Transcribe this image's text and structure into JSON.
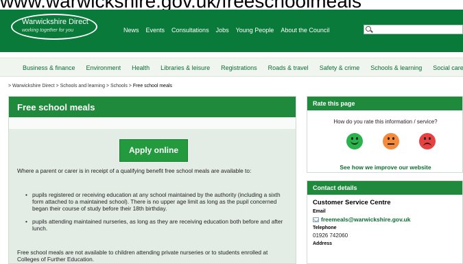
{
  "caption": {
    "url_text": "www.warwickshire.gov.uk/freeschoolmeals"
  },
  "header": {
    "logo_main": "Warwickshire Direct",
    "logo_sub": "working together for you",
    "nav": [
      "News",
      "Events",
      "Consultations",
      "Jobs",
      "Young People",
      "About the Council"
    ],
    "search": {
      "value": "",
      "icon": "search-icon"
    },
    "color": "#0a7a3a"
  },
  "main_nav": [
    "Business & finance",
    "Environment",
    "Health",
    "Libraries & leisure",
    "Registrations",
    "Roads & travel",
    "Safety & crime",
    "Schools & learning",
    "Social care"
  ],
  "breadcrumb": {
    "trail": "> Warwickshire Direct > Schools and learning > Schools > ",
    "current": "Free school meals"
  },
  "content": {
    "title": "Free school meals",
    "apply_label": "Apply online",
    "intro": "Where a parent or carer is in receipt of a qualifying benefit free school meals are available to:",
    "bullets": [
      "pupils registered or receiving education at any school maintained by the authority (including a sixth form attached to a maintained school). There is no upper age limit as long as the pupil concerned began their course of study before their 18th birthday.",
      "pupils attending maintained nurseries, as long as they are receiving education both before and after lunch."
    ],
    "footer": "Free school meals are not available to children attending private nurseries or to students enrolled at Colleges of Further Education."
  },
  "rate_panel": {
    "title": "Rate this page",
    "question": "How do you rate this information / service?",
    "faces": [
      {
        "icon": "happy-face-icon",
        "color": "#29b34a"
      },
      {
        "icon": "neutral-face-icon",
        "color": "#f48a3a"
      },
      {
        "icon": "sad-face-icon",
        "color": "#e84141"
      }
    ],
    "link": "See how we improve our website"
  },
  "contact_panel": {
    "title": "Contact details",
    "org": "Customer Service Centre",
    "email_label": "Email",
    "email": "freemeals@warwickshire.gov.uk",
    "phone_label": "Telephone",
    "phone": "01926 742060",
    "address_label": "Address"
  }
}
